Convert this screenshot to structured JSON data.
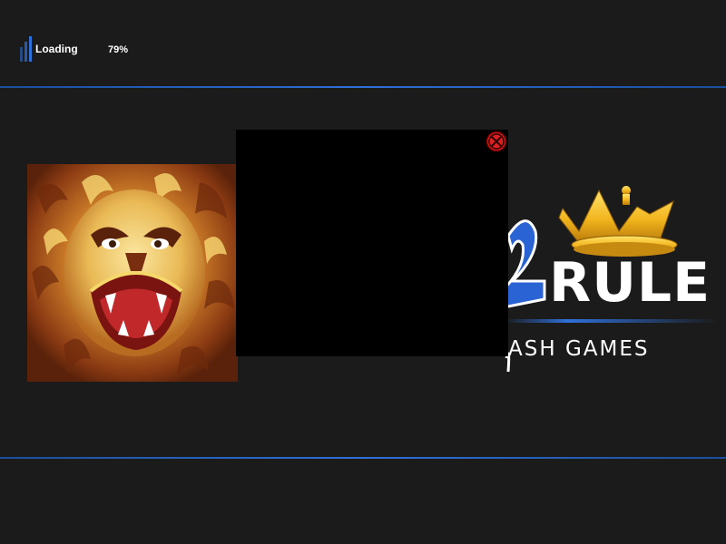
{
  "loader": {
    "label": "Loading",
    "percent": "79%",
    "progress": 0.79
  },
  "logo": {
    "word": "RULE",
    "tagline": "ASH GAMES"
  },
  "colors": {
    "background": "#1b1b1b",
    "accent": "#2f6fd8",
    "modal": "#000000",
    "close": "#e02020",
    "crown": "#f2b51d"
  },
  "icons": {
    "close": "close-circle-icon",
    "loader": "signal-bars-icon"
  }
}
